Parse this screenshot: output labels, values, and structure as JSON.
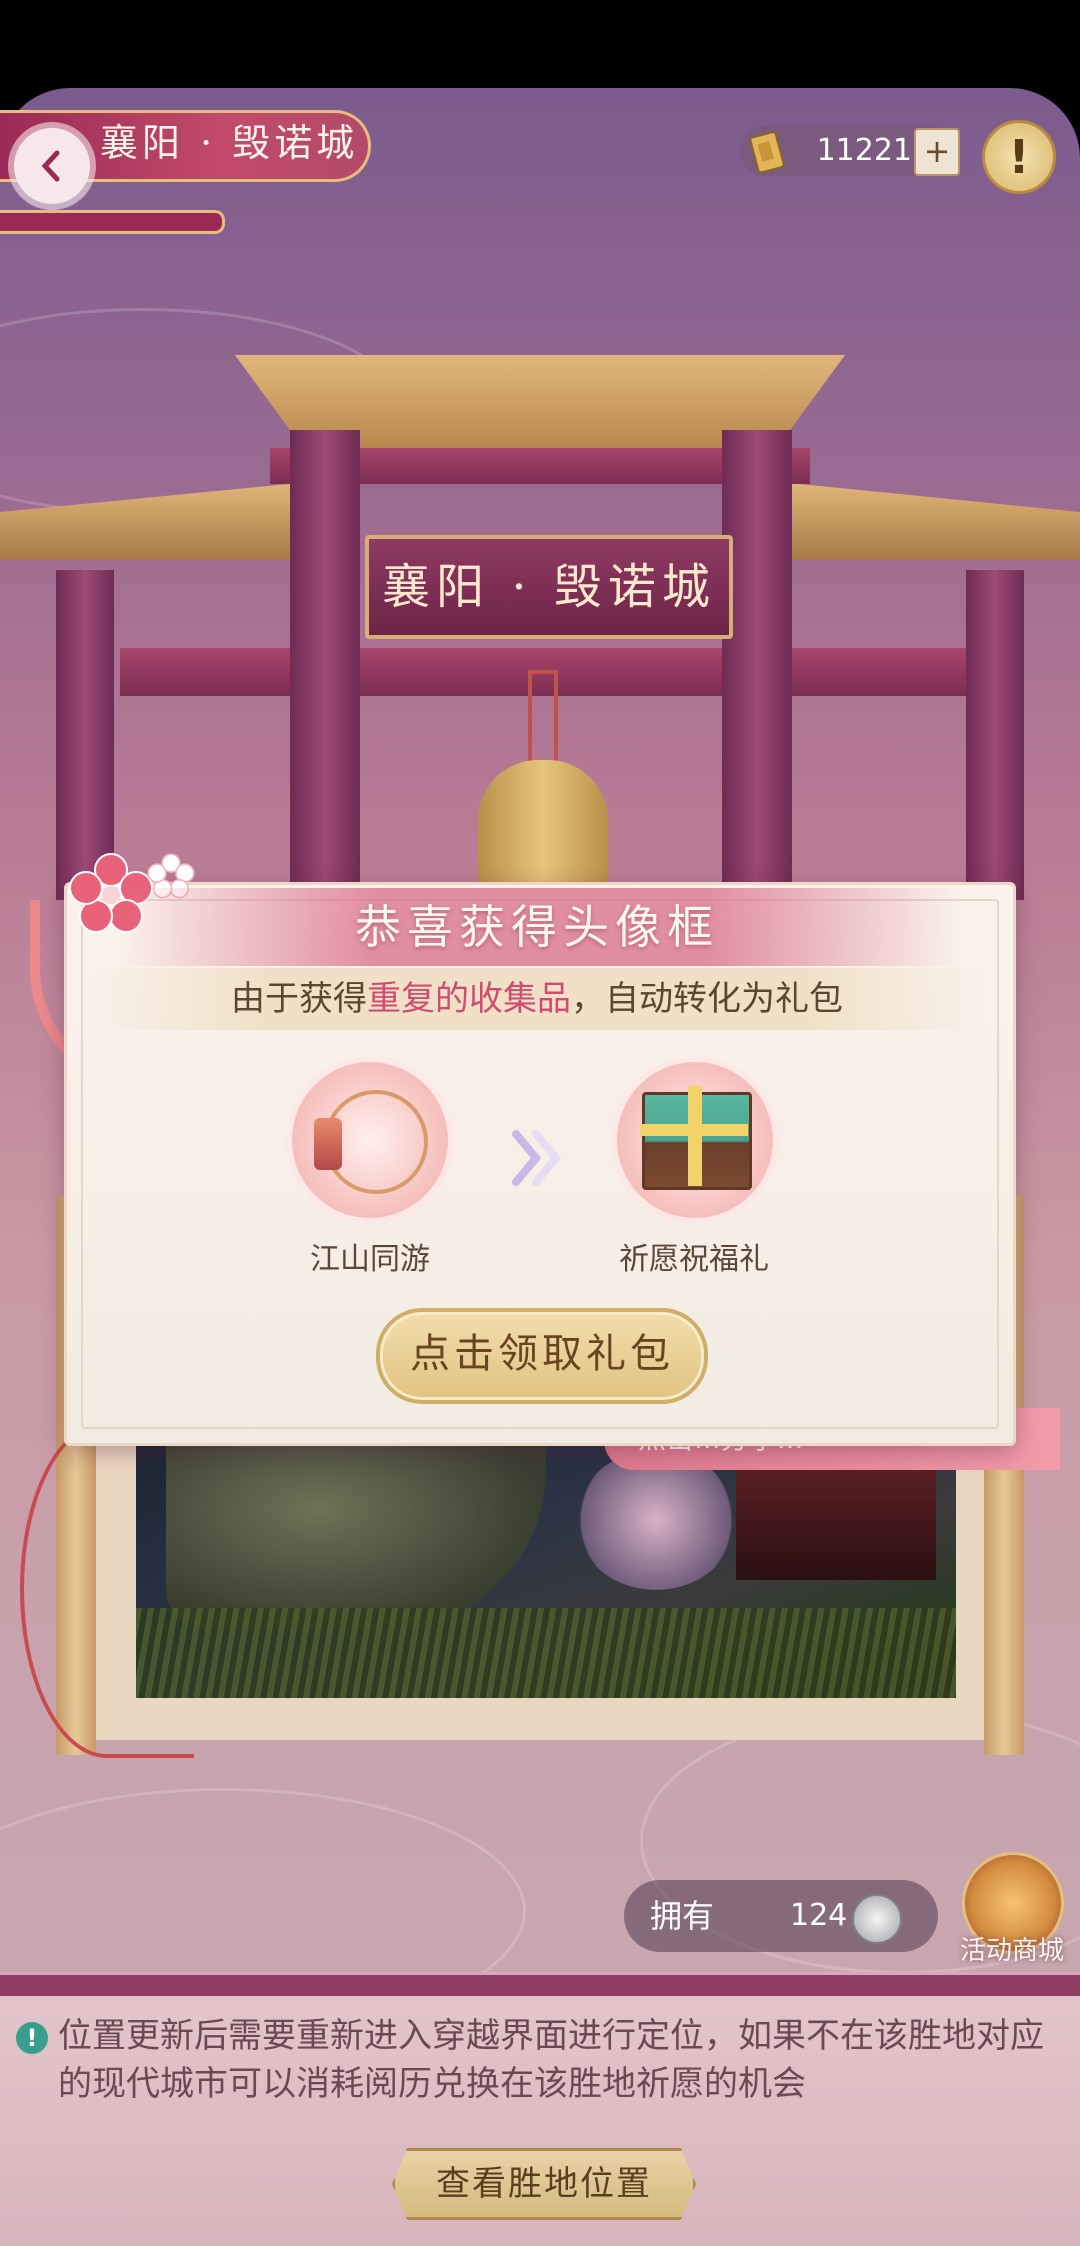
{
  "header": {
    "location_title": "襄阳 · 毁诺城",
    "currency_amount": "11221",
    "plus_label": "+",
    "alert_label": "!"
  },
  "gate": {
    "plaque_text": "襄阳 · 毁诺城"
  },
  "video": {
    "share_banner_text": "点击...分享..."
  },
  "owned": {
    "label": "拥有",
    "count": "124"
  },
  "shop": {
    "label": "活动商城"
  },
  "notice": {
    "text": "位置更新后需要重新进入穿越界面进行定位，如果不在该胜地对应的现代城市可以消耗阅历兑换在该胜地祈愿的机会",
    "button_label": "查看胜地位置"
  },
  "modal": {
    "title": "恭喜获得头像框",
    "subtitle_prefix": "由于获得",
    "subtitle_highlight": "重复的收集品",
    "subtitle_suffix": "，自动转化为礼包",
    "from_item": {
      "label": "江山同游",
      "icon": "avatar-frame-icon"
    },
    "to_item": {
      "label": "祈愿祝福礼",
      "icon": "gift-box-icon"
    },
    "claim_button": "点击领取礼包"
  },
  "colors": {
    "accent_pink": "#d04b70",
    "gold": "#e1c282",
    "modal_bg": "#f7efe6"
  }
}
